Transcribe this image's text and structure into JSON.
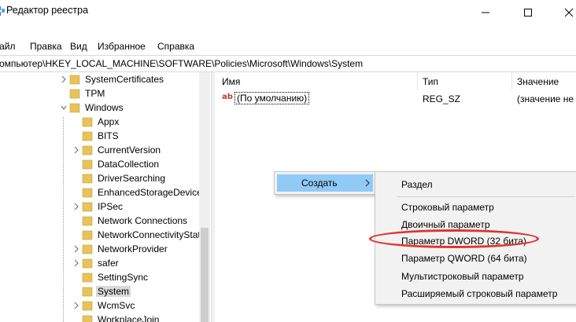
{
  "window": {
    "title": "Редактор реестра",
    "controls": [
      "minimize",
      "maximize",
      "close"
    ]
  },
  "menubar": {
    "items": [
      "Файл",
      "Правка",
      "Вид",
      "Избранное",
      "Справка"
    ]
  },
  "address": {
    "path": "Компьютер\\HKEY_LOCAL_MACHINE\\SOFTWARE\\Policies\\Microsoft\\Windows\\System"
  },
  "tree": {
    "items": [
      {
        "label": "SystemCertificates",
        "expandable": true,
        "expanded": false
      },
      {
        "label": "TPM",
        "expandable": false,
        "expanded": false
      },
      {
        "label": "Windows",
        "expandable": true,
        "expanded": true
      },
      {
        "label": "Appx",
        "expandable": false,
        "expanded": false
      },
      {
        "label": "BITS",
        "expandable": false,
        "expanded": false
      },
      {
        "label": "CurrentVersion",
        "expandable": true,
        "expanded": false
      },
      {
        "label": "DataCollection",
        "expandable": false,
        "expanded": false
      },
      {
        "label": "DriverSearching",
        "expandable": false,
        "expanded": false
      },
      {
        "label": "EnhancedStorageDevices",
        "expandable": false,
        "expanded": false
      },
      {
        "label": "IPSec",
        "expandable": true,
        "expanded": false
      },
      {
        "label": "Network Connections",
        "expandable": false,
        "expanded": false
      },
      {
        "label": "NetworkConnectivityStatusIndicator",
        "expandable": false,
        "expanded": false
      },
      {
        "label": "NetworkProvider",
        "expandable": true,
        "expanded": false
      },
      {
        "label": "safer",
        "expandable": true,
        "expanded": false
      },
      {
        "label": "SettingSync",
        "expandable": false,
        "expanded": false
      },
      {
        "label": "System",
        "expandable": false,
        "expanded": false,
        "selected": true
      },
      {
        "label": "WcmSvc",
        "expandable": true,
        "expanded": false
      },
      {
        "label": "WorkplaceJoin",
        "expandable": false,
        "expanded": false
      }
    ]
  },
  "list": {
    "headers": {
      "name": "Имя",
      "type": "Тип",
      "data": "Значение"
    },
    "rows": [
      {
        "icon": "ab",
        "name": "(По умолчанию)",
        "type": "REG_SZ",
        "data": "(значение не"
      }
    ]
  },
  "context_menu": {
    "create_label": "Создать",
    "submenu": {
      "section": "Раздел",
      "items": [
        "Строковый параметр",
        "Двоичный параметр",
        "Параметр DWORD (32 бита)",
        "Параметр QWORD (64 бита)",
        "Мультистроковый параметр",
        "Расширяемый строковый параметр"
      ],
      "highlighted_item": "Параметр DWORD (32 бита)"
    }
  },
  "colors": {
    "menu_highlight": "#91c9f7",
    "folder": "#e8c25a",
    "annotation_oval": "#e0342f"
  }
}
